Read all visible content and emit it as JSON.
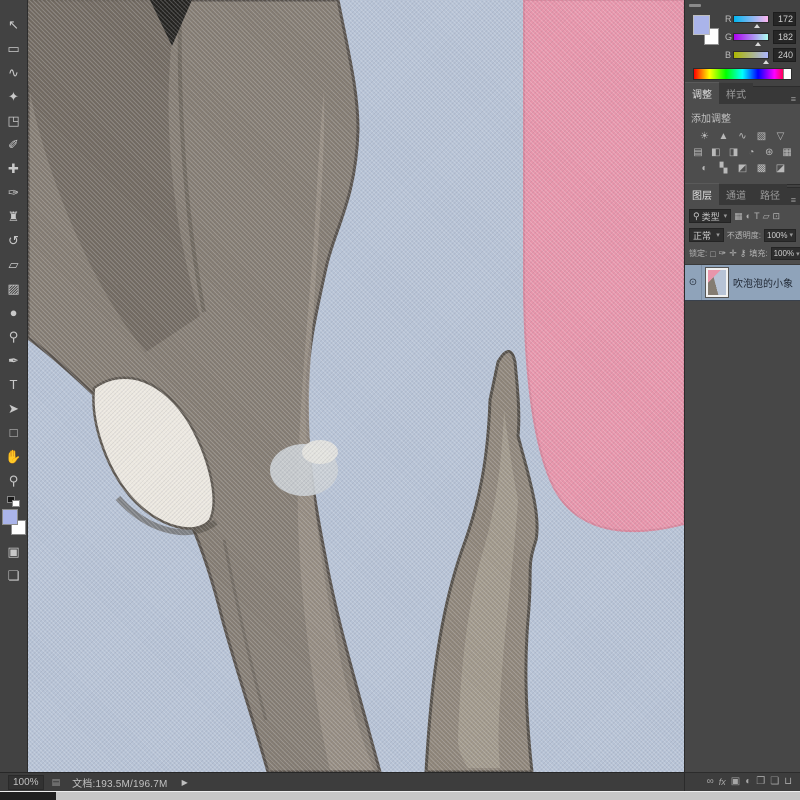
{
  "toolbar": {
    "tools": [
      {
        "name": "move-tool",
        "glyph": "↖"
      },
      {
        "name": "marquee-tool",
        "glyph": "▭"
      },
      {
        "name": "lasso-tool",
        "glyph": "∿"
      },
      {
        "name": "quick-selection-tool",
        "glyph": "✦"
      },
      {
        "name": "crop-tool",
        "glyph": "◳"
      },
      {
        "name": "eyedropper-tool",
        "glyph": "✐"
      },
      {
        "name": "healing-brush-tool",
        "glyph": "✚"
      },
      {
        "name": "brush-tool",
        "glyph": "✑"
      },
      {
        "name": "clone-stamp-tool",
        "glyph": "♜"
      },
      {
        "name": "history-brush-tool",
        "glyph": "↺"
      },
      {
        "name": "eraser-tool",
        "glyph": "▱"
      },
      {
        "name": "gradient-tool",
        "glyph": "▨"
      },
      {
        "name": "blur-tool",
        "glyph": "●"
      },
      {
        "name": "dodge-tool",
        "glyph": "⚲"
      },
      {
        "name": "pen-tool",
        "glyph": "✒"
      },
      {
        "name": "type-tool",
        "glyph": "T"
      },
      {
        "name": "path-selection-tool",
        "glyph": "➤"
      },
      {
        "name": "shape-tool",
        "glyph": "□"
      },
      {
        "name": "hand-tool",
        "glyph": "✋"
      },
      {
        "name": "zoom-tool",
        "glyph": "⚲"
      }
    ],
    "quick_mask_glyph": "▣",
    "screen_mode_glyph": "❏",
    "foreground_color": "#aab4ea",
    "background_color": "#ffffff"
  },
  "color_panel": {
    "channels": [
      {
        "label": "R",
        "value": "172",
        "num": 172
      },
      {
        "label": "G",
        "value": "182",
        "num": 182
      },
      {
        "label": "B",
        "value": "240",
        "num": 240
      }
    ],
    "foreground_color": "#aab4ea",
    "background_color": "#ffffff"
  },
  "adjustments_panel": {
    "tab_adjustments": "调整",
    "tab_styles": "样式",
    "header": "添加调整",
    "menu_glyph": "≡",
    "rows": [
      [
        {
          "name": "brightness-contrast-icon",
          "glyph": "☀"
        },
        {
          "name": "levels-icon",
          "glyph": "▲"
        },
        {
          "name": "curves-icon",
          "glyph": "∿"
        },
        {
          "name": "exposure-icon",
          "glyph": "▧"
        },
        {
          "name": "vibrance-icon",
          "glyph": "▽"
        }
      ],
      [
        {
          "name": "hue-saturation-icon",
          "glyph": "▤"
        },
        {
          "name": "color-balance-icon",
          "glyph": "◧"
        },
        {
          "name": "black-white-icon",
          "glyph": "◨"
        },
        {
          "name": "photo-filter-icon",
          "glyph": "◔"
        },
        {
          "name": "channel-mixer-icon",
          "glyph": "⊛"
        },
        {
          "name": "color-lookup-icon",
          "glyph": "▦"
        }
      ],
      [
        {
          "name": "invert-icon",
          "glyph": "◐"
        },
        {
          "name": "posterize-icon",
          "glyph": "▚"
        },
        {
          "name": "threshold-icon",
          "glyph": "◩"
        },
        {
          "name": "gradient-map-icon",
          "glyph": "▩"
        },
        {
          "name": "selective-color-icon",
          "glyph": "◪"
        }
      ]
    ]
  },
  "layers_panel": {
    "tab_layers": "图层",
    "tab_channels": "通道",
    "tab_paths": "路径",
    "menu_glyph": "≡",
    "filter_search_glyph": "⚲",
    "filter_label": "类型",
    "filter_icons": [
      {
        "name": "pixel-filter-icon",
        "glyph": "▦"
      },
      {
        "name": "adjustment-filter-icon",
        "glyph": "◐"
      },
      {
        "name": "type-filter-icon",
        "glyph": "T"
      },
      {
        "name": "shape-filter-icon",
        "glyph": "▱"
      },
      {
        "name": "smart-object-filter-icon",
        "glyph": "⊡"
      }
    ],
    "blend_mode": "正常",
    "opacity_label": "不透明度:",
    "opacity_value": "100%",
    "lock_label": "锁定:",
    "lock_icons": [
      {
        "name": "lock-transparency-icon",
        "glyph": "□"
      },
      {
        "name": "lock-pixels-icon",
        "glyph": "✑"
      },
      {
        "name": "lock-position-icon",
        "glyph": "✛"
      },
      {
        "name": "lock-all-icon",
        "glyph": "⚷"
      }
    ],
    "fill_label": "填充:",
    "fill_value": "100%",
    "layer": {
      "name": "吹泡泡的小象",
      "visible": true,
      "selected": true,
      "eye_glyph": "⊙"
    },
    "footer_icons": [
      {
        "name": "link-layers-icon",
        "glyph": "∞"
      },
      {
        "name": "layer-style-icon",
        "glyph": "fx"
      },
      {
        "name": "add-mask-icon",
        "glyph": "▣"
      },
      {
        "name": "new-adjustment-layer-icon",
        "glyph": "◐"
      },
      {
        "name": "new-group-icon",
        "glyph": "❐"
      },
      {
        "name": "new-layer-icon",
        "glyph": "❏"
      },
      {
        "name": "delete-layer-icon",
        "glyph": "⊔"
      }
    ]
  },
  "status_bar": {
    "zoom": "100%",
    "info_icon_glyph": "▤",
    "document_info": "文档:193.5M/196.7M",
    "flyout_glyph": "▶"
  },
  "canvas": {
    "palette": {
      "background_blue": "#b7c3d6",
      "elephant_gray": "#847c72",
      "elephant_dark": "#6f675e",
      "outline": "#57514b",
      "tusk_white": "#ece8e0",
      "pink_area": "#e895ab",
      "leg_gray": "#8e8579"
    }
  }
}
